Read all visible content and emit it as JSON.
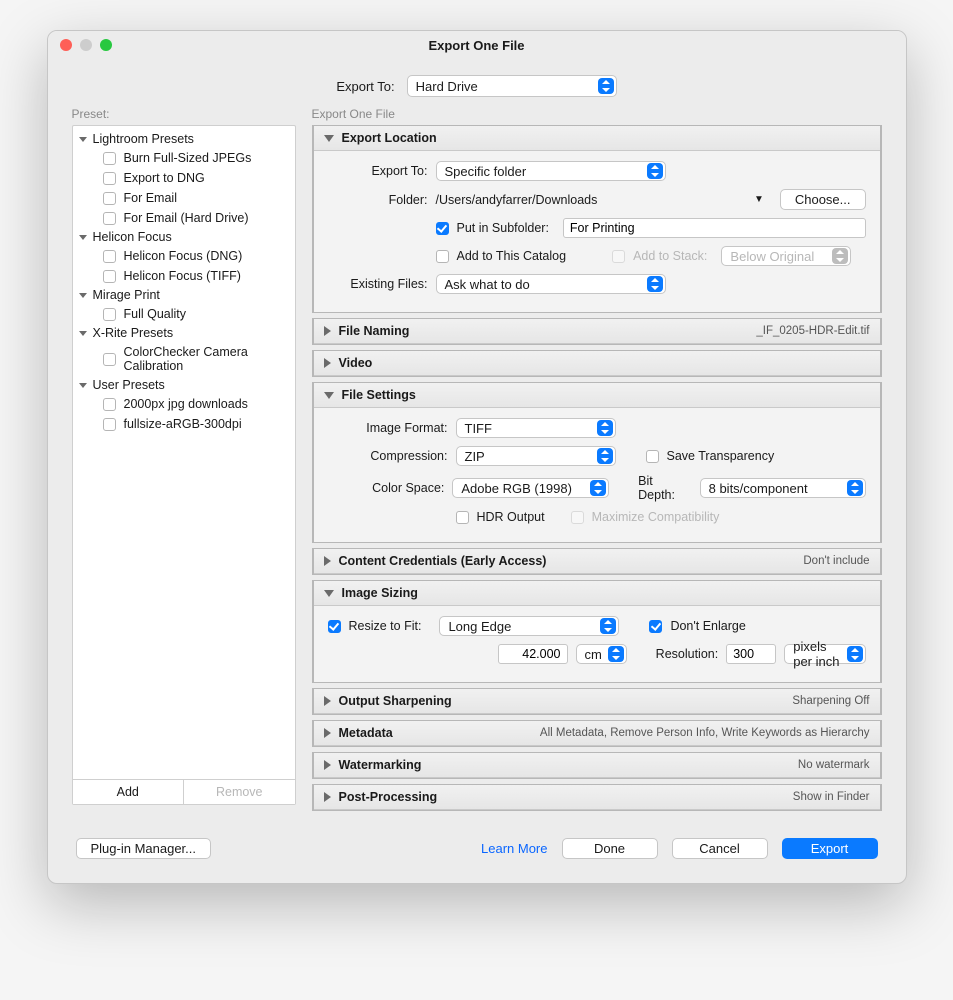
{
  "window": {
    "title": "Export One File",
    "export_to_label": "Export To:",
    "export_to_value": "Hard Drive",
    "preset_label": "Preset:",
    "subtitle": "Export One File"
  },
  "sidebar": {
    "groups": [
      {
        "name": "Lightroom Presets",
        "items": [
          "Burn Full-Sized JPEGs",
          "Export to DNG",
          "For Email",
          "For Email (Hard Drive)"
        ]
      },
      {
        "name": "Helicon Focus",
        "items": [
          "Helicon Focus (DNG)",
          "Helicon Focus (TIFF)"
        ]
      },
      {
        "name": "Mirage Print",
        "items": [
          "Full Quality"
        ]
      },
      {
        "name": "X-Rite Presets",
        "items": [
          "ColorChecker Camera Calibration"
        ]
      },
      {
        "name": "User Presets",
        "items": [
          "2000px jpg downloads",
          "fullsize-aRGB-300dpi"
        ]
      }
    ],
    "add": "Add",
    "remove": "Remove"
  },
  "panels": {
    "export_location": {
      "title": "Export Location",
      "export_to_label": "Export To:",
      "export_to_value": "Specific folder",
      "folder_label": "Folder:",
      "folder_value": "/Users/andyfarrer/Downloads",
      "choose": "Choose...",
      "put_in_subfolder": "Put in Subfolder:",
      "subfolder_value": "For Printing",
      "add_to_catalog": "Add to This Catalog",
      "add_to_stack": "Add to Stack:",
      "stack_value": "Below Original",
      "existing_label": "Existing Files:",
      "existing_value": "Ask what to do"
    },
    "file_naming": {
      "title": "File Naming",
      "summary": "_IF_0205-HDR-Edit.tif"
    },
    "video": {
      "title": "Video"
    },
    "file_settings": {
      "title": "File Settings",
      "image_format_label": "Image Format:",
      "image_format_value": "TIFF",
      "compression_label": "Compression:",
      "compression_value": "ZIP",
      "save_transparency": "Save Transparency",
      "color_space_label": "Color Space:",
      "color_space_value": "Adobe RGB (1998)",
      "bit_depth_label": "Bit Depth:",
      "bit_depth_value": "8 bits/component",
      "hdr_output": "HDR Output",
      "maximize_compat": "Maximize Compatibility"
    },
    "content_credentials": {
      "title": "Content Credentials (Early Access)",
      "summary": "Don't include"
    },
    "image_sizing": {
      "title": "Image Sizing",
      "resize_label": "Resize to Fit:",
      "resize_value": "Long Edge",
      "dont_enlarge": "Don't Enlarge",
      "dim_value": "42.000",
      "dim_unit": "cm",
      "resolution_label": "Resolution:",
      "resolution_value": "300",
      "resolution_unit": "pixels per inch"
    },
    "output_sharpening": {
      "title": "Output Sharpening",
      "summary": "Sharpening Off"
    },
    "metadata": {
      "title": "Metadata",
      "summary": "All Metadata, Remove Person Info, Write Keywords as Hierarchy"
    },
    "watermarking": {
      "title": "Watermarking",
      "summary": "No watermark"
    },
    "post_processing": {
      "title": "Post-Processing",
      "summary": "Show in Finder"
    }
  },
  "footer": {
    "plugin": "Plug-in Manager...",
    "learn_more": "Learn More",
    "done": "Done",
    "cancel": "Cancel",
    "export": "Export"
  }
}
